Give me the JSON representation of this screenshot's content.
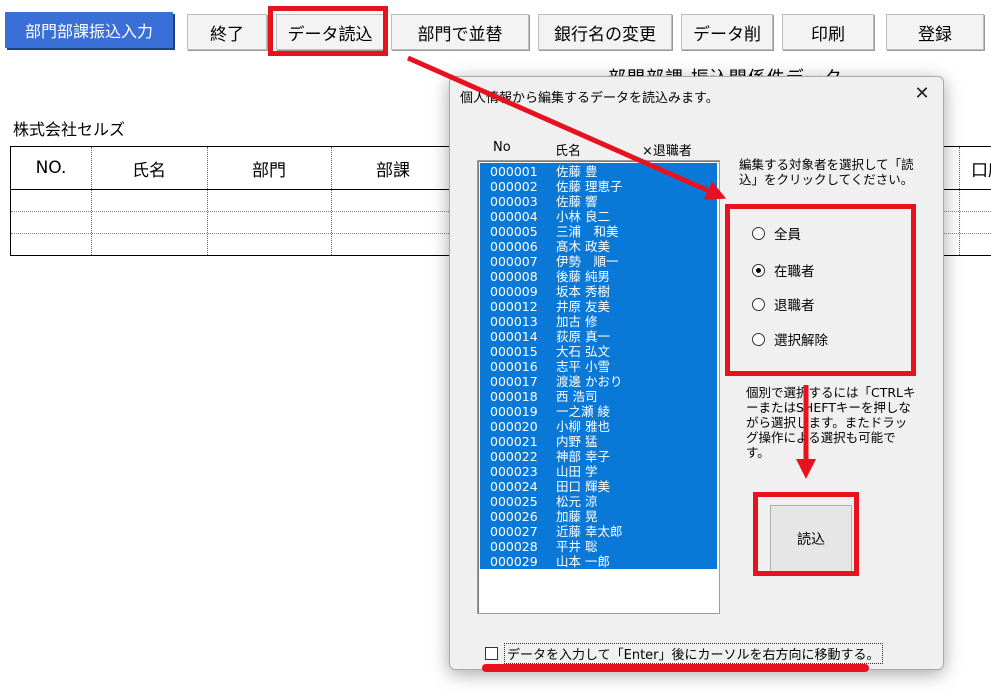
{
  "toolbar": {
    "app_title": "部門部課振込入力",
    "buttons": [
      {
        "id": "exit",
        "label": "終了"
      },
      {
        "id": "read-data",
        "label": "データ読込"
      },
      {
        "id": "sort-dept",
        "label": "部門で並替"
      },
      {
        "id": "change-bank",
        "label": "銀行名の変更"
      },
      {
        "id": "delete-data",
        "label": "データ削"
      },
      {
        "id": "print",
        "label": "印刷"
      },
      {
        "id": "register",
        "label": "登録"
      }
    ]
  },
  "sheet": {
    "heading": "部門部課 振込関係件データ",
    "company": "株式会社セルズ",
    "columns": [
      "NO.",
      "氏名",
      "部門",
      "部課",
      "口座"
    ]
  },
  "dialog": {
    "title": "個人情報から編集するデータを読込みます。",
    "close_symbol": "✕",
    "list_headers": {
      "no": "No",
      "name": "氏名",
      "retired": "×退職者"
    },
    "employees": [
      {
        "no": "000001",
        "name": "佐藤 豊"
      },
      {
        "no": "000002",
        "name": "佐藤 理恵子"
      },
      {
        "no": "000003",
        "name": "佐藤 響"
      },
      {
        "no": "000004",
        "name": "小林 良二"
      },
      {
        "no": "000005",
        "name": "三浦　和美"
      },
      {
        "no": "000006",
        "name": "髙木 政美"
      },
      {
        "no": "000007",
        "name": "伊勢　順一"
      },
      {
        "no": "000008",
        "name": "後藤 純男"
      },
      {
        "no": "000009",
        "name": "坂本 秀樹"
      },
      {
        "no": "000012",
        "name": "井原 友美"
      },
      {
        "no": "000013",
        "name": "加古 修"
      },
      {
        "no": "000014",
        "name": "荻原 真一"
      },
      {
        "no": "000015",
        "name": "大石 弘文"
      },
      {
        "no": "000016",
        "name": "志平 小雪"
      },
      {
        "no": "000017",
        "name": "渡邊 かおり"
      },
      {
        "no": "000018",
        "name": "西 浩司"
      },
      {
        "no": "000019",
        "name": "一之瀬 綾"
      },
      {
        "no": "000020",
        "name": "小柳 雅也"
      },
      {
        "no": "000021",
        "name": "内野 猛"
      },
      {
        "no": "000022",
        "name": "神部 幸子"
      },
      {
        "no": "000023",
        "name": "山田 学"
      },
      {
        "no": "000024",
        "name": "田口 輝美"
      },
      {
        "no": "000025",
        "name": "松元 涼"
      },
      {
        "no": "000026",
        "name": "加藤 晃"
      },
      {
        "no": "000027",
        "name": "近藤 幸太郎"
      },
      {
        "no": "000028",
        "name": "平井 聡"
      },
      {
        "no": "000029",
        "name": "山本 一郎"
      }
    ],
    "instruction": "編集する対象者を選択して「読込」をクリックしてください。",
    "radios": [
      {
        "label": "全員",
        "checked": false
      },
      {
        "label": "在職者",
        "checked": true
      },
      {
        "label": "退職者",
        "checked": false
      },
      {
        "label": "選択解除",
        "checked": false
      }
    ],
    "help": "個別で選択するには「CTRLキーまたはSHEFTキーを押しながら選択します。またドラッグ操作による選択も可能です。",
    "read_button": "読込",
    "checkbox_label": "データを入力して「Enter」後にカーソルを右方向に移動する。",
    "checkbox_checked": false
  },
  "colors": {
    "accent": "#3a6fd8",
    "selection": "#0a78d7",
    "annotation": "#e8121f"
  }
}
